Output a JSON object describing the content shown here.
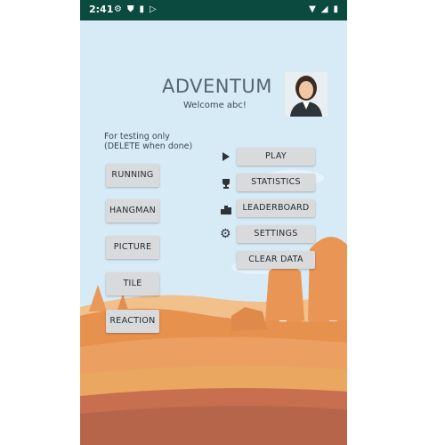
{
  "status_bar": {
    "time": "2:41",
    "left_icons": [
      "settings-gear-icon",
      "shield-icon",
      "sd-card-icon",
      "play-store-icon"
    ],
    "right_icons": [
      "wifi-icon",
      "signal-icon",
      "battery-icon"
    ]
  },
  "header": {
    "app_title": "ADVENTUM",
    "welcome_text": "Welcome abc!"
  },
  "testing_note": {
    "line1": "For testing only",
    "line2": "(DELETE when done)"
  },
  "test_buttons": [
    {
      "label": "RUNNING"
    },
    {
      "label": "HANGMAN"
    },
    {
      "label": "PICTURE"
    },
    {
      "label": "TILE"
    },
    {
      "label": "REACTION"
    }
  ],
  "menu": [
    {
      "label": "PLAY",
      "icon": "play-icon"
    },
    {
      "label": "STATISTICS",
      "icon": "trophy-icon"
    },
    {
      "label": "LEADERBOARD",
      "icon": "podium-icon"
    },
    {
      "label": "SETTINGS",
      "icon": "gear-icon"
    },
    {
      "label": "CLEAR DATA",
      "icon": ""
    }
  ],
  "colors": {
    "status_bar": "#0b4a3f",
    "sky": "#d6ebf6",
    "button": "#d9dadb",
    "title": "#56656f",
    "hill_orange": "#e9a05a",
    "hill_brown": "#b6654a"
  }
}
